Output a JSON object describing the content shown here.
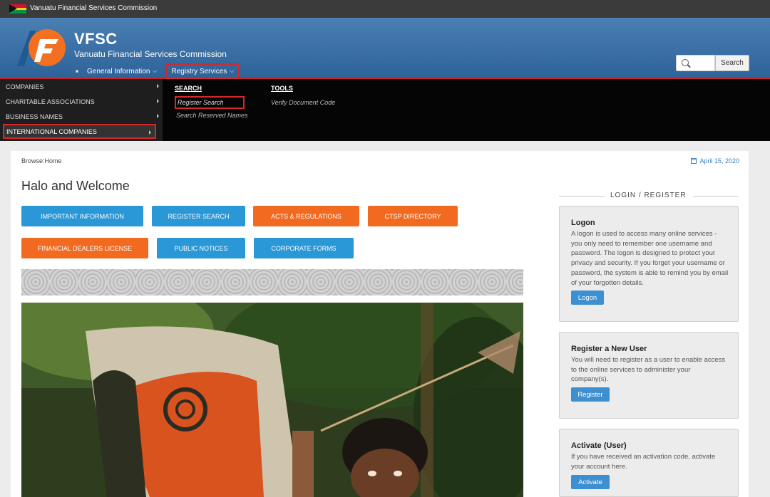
{
  "topbar": {
    "site_name": "Vanuatu Financial Services Commission"
  },
  "header": {
    "brand": "VFSC",
    "brand_sub": "Vanuatu Financial Services Commission",
    "nav": [
      {
        "label": "General Information"
      },
      {
        "label": "Registry Services"
      }
    ],
    "search": {
      "placeholder": "",
      "button": "Search"
    }
  },
  "mega_menu": {
    "side_items": [
      {
        "label": "COMPANIES"
      },
      {
        "label": "CHARITABLE ASSOCIATIONS"
      },
      {
        "label": "BUSINESS NAMES"
      },
      {
        "label": "INTERNATIONAL COMPANIES"
      }
    ],
    "search_col": {
      "heading": "SEARCH",
      "links": [
        "Register Search",
        "Search Reserved Names"
      ]
    },
    "tools_col": {
      "heading": "TOOLS",
      "links": [
        "Verify Document Code"
      ]
    }
  },
  "content": {
    "breadcrumb": "Browse:Home",
    "date": "April 15, 2020",
    "title": "Halo and Welcome",
    "buttons": [
      {
        "label": "IMPORTANT INFORMATION",
        "color": "#2a97d6"
      },
      {
        "label": "REGISTER SEARCH",
        "color": "#2a97d6"
      },
      {
        "label": "ACTS & REGULATIONS",
        "color": "#f16a20"
      },
      {
        "label": "CTSP DIRECTORY",
        "color": "#f16a20"
      },
      {
        "label": "FINANCIAL DEALERS LICENSE",
        "color": "#f16a20"
      },
      {
        "label": "PUBLIC NOTICES",
        "color": "#2a97d6"
      },
      {
        "label": "CORPORATE FORMS",
        "color": "#2a97d6"
      }
    ]
  },
  "sidebar": {
    "heading": "LOGIN / REGISTER",
    "logon": {
      "title": "Logon",
      "text": "A logon is used to access many online services - you only need to remember one username and password. The logon is designed to protect your privacy and security. If you forget your username or password, the system is able to remind you by email of your forgotten details.",
      "button": "Logon"
    },
    "register": {
      "title": "Register a New User",
      "text": "You will need to register as a user to enable access to the online services to administer your company(s).",
      "button": "Register"
    },
    "activate": {
      "title": "Activate (User)",
      "text": "If you have received an activation code, activate your account here.",
      "button": "Activate"
    }
  }
}
